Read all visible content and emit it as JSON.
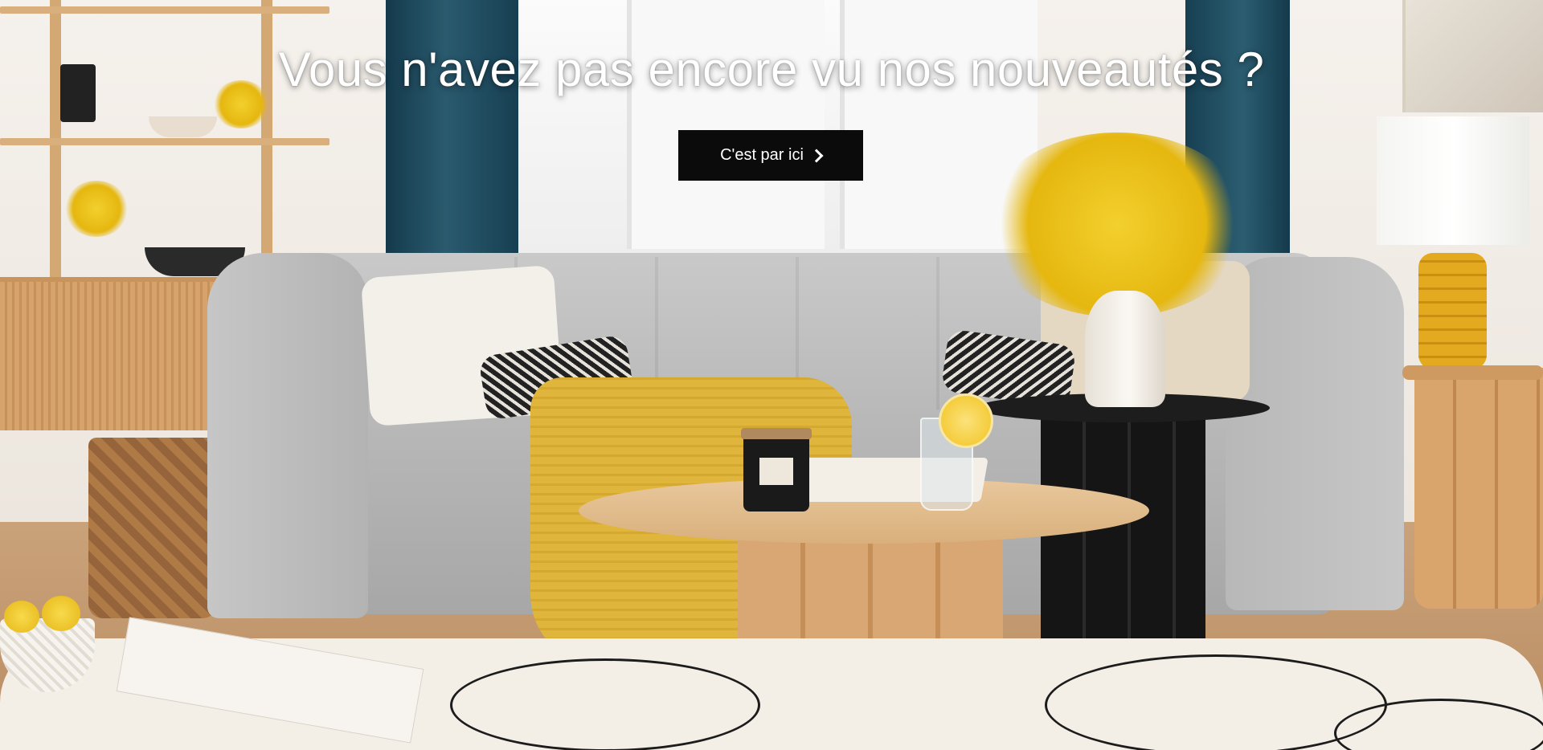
{
  "hero": {
    "headline": "Vous n'avez pas encore vu nos nouveautés ?",
    "cta_label": "C'est par ici",
    "cta_icon": "chevron-right-icon",
    "image_alt": "",
    "colors": {
      "headline_text": "#ffffff",
      "cta_background": "#0b0b0b",
      "cta_text": "#ffffff"
    }
  }
}
